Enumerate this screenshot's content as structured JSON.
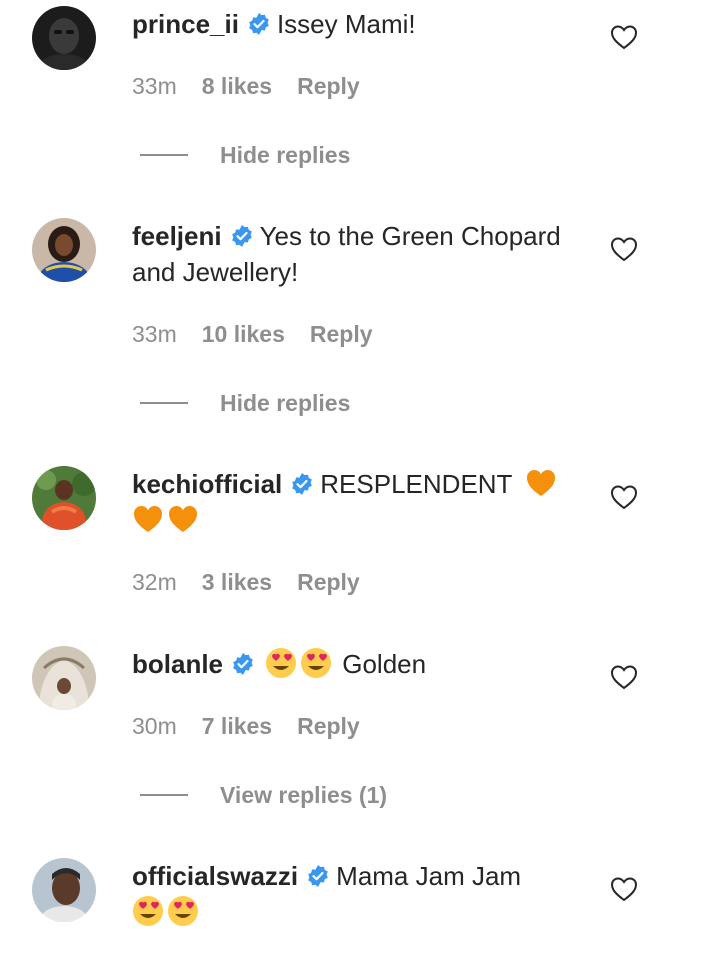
{
  "comments": [
    {
      "username": "prince_ii",
      "text": "Issey Mami!",
      "time": "33m",
      "likes": "8 likes",
      "reply": "Reply",
      "replies_toggle": "Hide replies"
    },
    {
      "username": "feeljeni",
      "text": "Yes to the Green Chopard and Jewellery!",
      "time": "33m",
      "likes": "10 likes",
      "reply": "Reply",
      "replies_toggle": "Hide replies"
    },
    {
      "username": "kechiofficial",
      "text": "RESPLENDENT",
      "emoji_after": "orange-heart x3",
      "time": "32m",
      "likes": "3 likes",
      "reply": "Reply"
    },
    {
      "username": "bolanle",
      "emoji_before": "heart-eyes x2",
      "text": "Golden",
      "time": "30m",
      "likes": "7 likes",
      "reply": "Reply",
      "replies_toggle": "View replies (1)"
    },
    {
      "username": "officialswazzi",
      "text": "Mama Jam Jam",
      "emoji_after": "heart-eyes x2"
    }
  ],
  "colors": {
    "text": "#262626",
    "muted": "#8e8e8e",
    "verified": "#3897f0",
    "orange_heart": "#f4900c",
    "emoji_face": "#ffcc4d",
    "emoji_heart": "#e0245e"
  }
}
